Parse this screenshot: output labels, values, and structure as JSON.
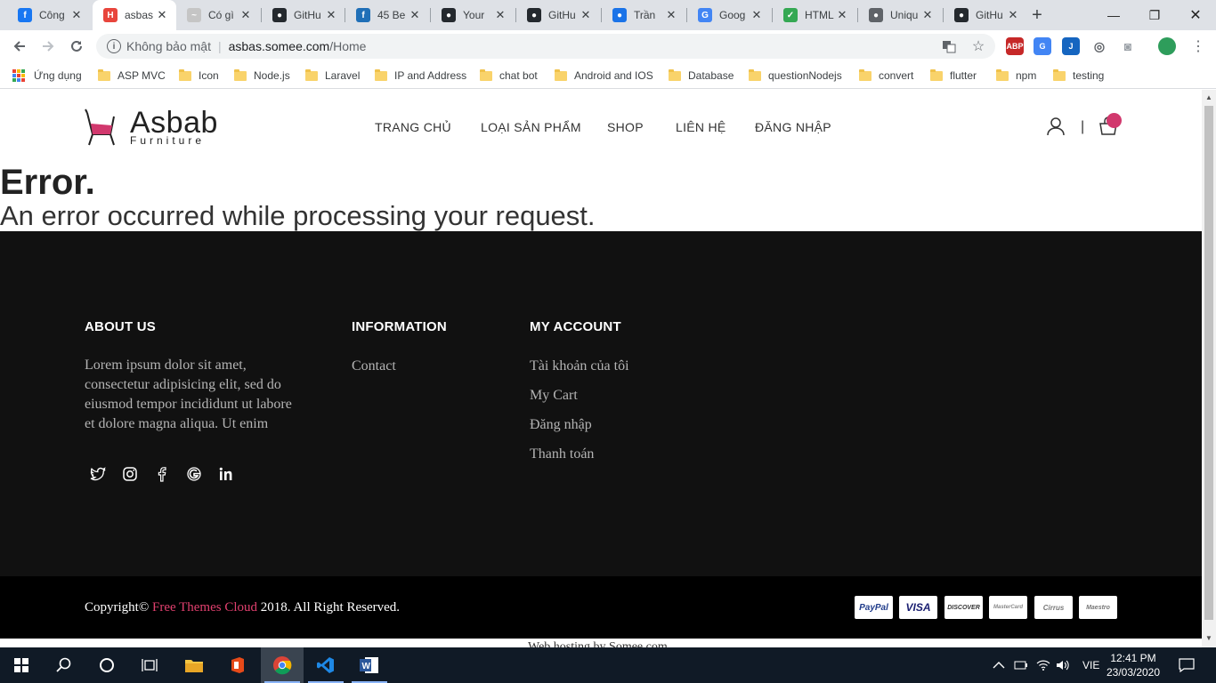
{
  "browser": {
    "tabs": [
      {
        "title": "Công",
        "icon": "facebook-icon",
        "color": "#1877f2",
        "glyph": "f"
      },
      {
        "title": "asbas",
        "icon": "site-favicon-icon",
        "color": "#e8453c",
        "glyph": "H",
        "active": true
      },
      {
        "title": "Có gì",
        "icon": "mail-icon",
        "color": "#c5c5c5",
        "glyph": "~"
      },
      {
        "title": "GitHu",
        "icon": "github-icon",
        "color": "#24292e",
        "glyph": "●"
      },
      {
        "title": "45 Be",
        "icon": "document-icon",
        "color": "#1f6fb7",
        "glyph": "f"
      },
      {
        "title": "Your",
        "icon": "github-icon",
        "color": "#24292e",
        "glyph": "●"
      },
      {
        "title": "GitHu",
        "icon": "github-icon",
        "color": "#24292e",
        "glyph": "●"
      },
      {
        "title": "Trần",
        "icon": "profile-icon",
        "color": "#1a73e8",
        "glyph": "●"
      },
      {
        "title": "Goog",
        "icon": "google-translate-icon",
        "color": "#4285f4",
        "glyph": "G"
      },
      {
        "title": "HTML",
        "icon": "checkmark-icon",
        "color": "#34a853",
        "glyph": "✓"
      },
      {
        "title": "Uniqu",
        "icon": "globe-icon",
        "color": "#5f6368",
        "glyph": "●"
      },
      {
        "title": "GitHu",
        "icon": "github-icon",
        "color": "#24292e",
        "glyph": "●"
      }
    ],
    "new_tab": "+",
    "close_glyph": "✕",
    "window": {
      "minimize": "—",
      "restore": "❐",
      "close": "✕"
    },
    "address": {
      "security_label": "Không bảo mật",
      "separator": "|",
      "host": "asbas.somee.com",
      "path": "/Home"
    },
    "bookmarks": [
      {
        "label": "Ứng dụng",
        "type": "apps"
      },
      {
        "label": "ASP MVC",
        "type": "folder"
      },
      {
        "label": "Icon",
        "type": "folder"
      },
      {
        "label": "Node.js",
        "type": "folder"
      },
      {
        "label": "Laravel",
        "type": "folder"
      },
      {
        "label": "IP and Address",
        "type": "folder"
      },
      {
        "label": "chat bot",
        "type": "folder"
      },
      {
        "label": "Android and IOS",
        "type": "folder"
      },
      {
        "label": "Database",
        "type": "folder"
      },
      {
        "label": "questionNodejs",
        "type": "folder"
      },
      {
        "label": "convert",
        "type": "folder"
      },
      {
        "label": "flutter",
        "type": "folder"
      },
      {
        "label": "npm",
        "type": "folder"
      },
      {
        "label": "testing",
        "type": "folder"
      }
    ]
  },
  "site": {
    "logo": {
      "name": "Asbab",
      "tagline": "Furniture"
    },
    "nav": [
      "TRANG CHỦ",
      "LOẠI SẢN PHẨM",
      "SHOP",
      "LIÊN HỆ",
      "ĐĂNG NHẬP"
    ],
    "header_separator": "|",
    "accent_color": "#d1386d"
  },
  "error": {
    "title": "Error.",
    "message": "An error occurred while processing your request."
  },
  "footer": {
    "about": {
      "title": "ABOUT US",
      "lines": [
        "Lorem ipsum dolor sit amet,",
        "consectetur adipisicing elit, sed do",
        "eiusmod tempor incididunt ut labore",
        "et dolore magna aliqua. Ut enim"
      ],
      "social": [
        "twitter-icon",
        "instagram-icon",
        "facebook-icon",
        "google-plus-icon",
        "linkedin-icon"
      ]
    },
    "information": {
      "title": "INFORMATION",
      "links": [
        "Contact"
      ]
    },
    "account": {
      "title": "MY ACCOUNT",
      "links": [
        "Tài khoản của tôi",
        "My Cart",
        "Đăng nhập",
        "Thanh toán"
      ]
    },
    "copyright": {
      "prefix": "Copyright©",
      "brand": "Free Themes Cloud",
      "suffix": "2018. All Right Reserved."
    },
    "payments": [
      "PayPal",
      "VISA",
      "DISCOVER",
      "MasterCard",
      "Cirrus",
      "Maestro"
    ],
    "hosting": "Web hosting by Somee.com"
  },
  "taskbar": {
    "apps": [
      "file-explorer-icon",
      "office-icon",
      "chrome-icon",
      "vscode-icon",
      "word-icon"
    ],
    "language": "VIE",
    "time": "12:41 PM",
    "date": "23/03/2020"
  }
}
